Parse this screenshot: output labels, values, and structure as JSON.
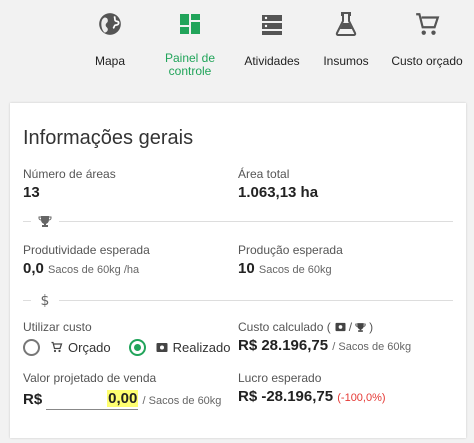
{
  "nav": {
    "items": [
      {
        "label": "Mapa",
        "icon": "globe-icon"
      },
      {
        "label": "Painel de controle",
        "icon": "dashboard-icon",
        "active": true
      },
      {
        "label": "Atividades",
        "icon": "storage-icon"
      },
      {
        "label": "Insumos",
        "icon": "flask-icon"
      },
      {
        "label": "Custo orçado",
        "icon": "cart-icon"
      }
    ]
  },
  "card": {
    "title": "Informações gerais",
    "num_areas_label": "Número de áreas",
    "num_areas_value": "13",
    "area_total_label": "Área total",
    "area_total_value": "1.063,13 ha",
    "prod_esperada_label": "Produtividade esperada",
    "prod_esperada_value": "0,0",
    "prod_esperada_unit": "Sacos de 60kg /ha",
    "producao_label": "Produção esperada",
    "producao_value": "10",
    "producao_unit": "Sacos de 60kg",
    "utilizar_custo_label": "Utilizar custo",
    "orcado_label": "Orçado",
    "realizado_label": "Realizado",
    "selected_cost": "Realizado",
    "custo_calc_label": "Custo calculado (",
    "custo_calc_label_end": ")",
    "custo_calc_value": "R$ 28.196,75",
    "custo_calc_unit": "/ Sacos de 60kg",
    "valor_proj_label": "Valor projetado de venda",
    "valor_prefix": "R$",
    "valor_value": "0,00",
    "valor_unit": "/ Sacos de 60kg",
    "lucro_label": "Lucro esperado",
    "lucro_value": "R$ -28.196,75",
    "lucro_pct": "(-100,0%)"
  },
  "colors": {
    "accent": "#21a45a",
    "negative": "#e53935",
    "highlight": "#ffff70"
  }
}
